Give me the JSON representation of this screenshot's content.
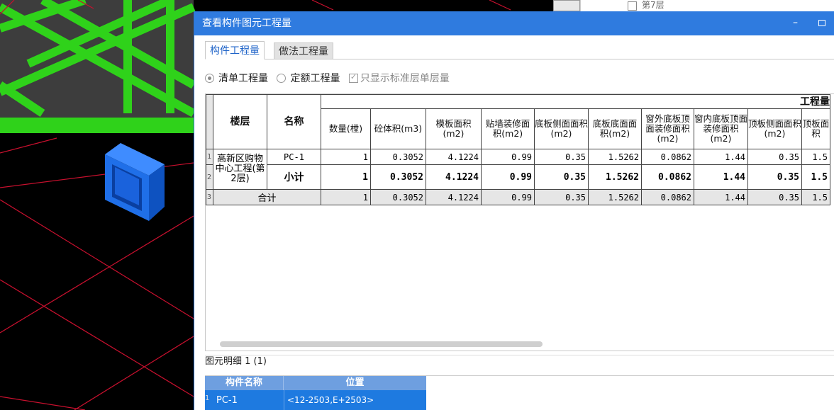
{
  "dialog": {
    "title": "查看构件图元工程量",
    "minimize_glyph": "–"
  },
  "background_panel": {
    "floor_label": "第7层"
  },
  "tabs": [
    {
      "label": "构件工程量",
      "active": true
    },
    {
      "label": "做法工程量",
      "active": false
    }
  ],
  "options": {
    "bill_quantity": "清单工程量",
    "quota_quantity": "定额工程量",
    "standard_floor_only": "只显示标准层单层量"
  },
  "table": {
    "group_header": "工程量",
    "headers": {
      "floor": "楼层",
      "name": "名称",
      "count": "数量(樘)",
      "concrete": "砼体积(m3)",
      "formwork": "模板面积(m2)",
      "tile": "贴墙装修面积(m2)",
      "bottom_side": "底板侧面面积(m2)",
      "bottom_bottom": "底板底面面积(m2)",
      "outer_bottom_top": "窗外底板顶面装修面积(m2)",
      "inner_bottom_top": "窗内底板顶面装修面积(m2)",
      "top_side": "顶板侧面面积(m2)",
      "top_next": "顶板面积"
    },
    "floor_value": "高新区购物中心工程(第2层)",
    "rows": [
      {
        "num": "1",
        "name": "PC-1",
        "values": [
          "1",
          "0.3052",
          "4.1224",
          "0.99",
          "0.35",
          "1.5262",
          "0.0862",
          "1.44",
          "0.35",
          "1.5"
        ]
      },
      {
        "num": "2",
        "name": "小计",
        "values": [
          "1",
          "0.3052",
          "4.1224",
          "0.99",
          "0.35",
          "1.5262",
          "0.0862",
          "1.44",
          "0.35",
          "1.5"
        ]
      }
    ],
    "total": {
      "num": "3",
      "label": "合计",
      "values": [
        "1",
        "0.3052",
        "4.1224",
        "0.99",
        "0.35",
        "1.5262",
        "0.0862",
        "1.44",
        "0.35",
        "1.5"
      ]
    }
  },
  "detail": {
    "title": "图元明细  1 (1)",
    "col_name": "构件名称",
    "col_position": "位置",
    "rows": [
      {
        "num": "1",
        "name": "PC-1",
        "position": "<12-2503,E+2503>"
      }
    ]
  },
  "colors": {
    "titlebar": "#2f7bdf",
    "grid_green": "#2fd21a",
    "axis_red": "#c8102e",
    "component_blue": "#1f6fe8",
    "selected_row": "#1e7ae0"
  }
}
